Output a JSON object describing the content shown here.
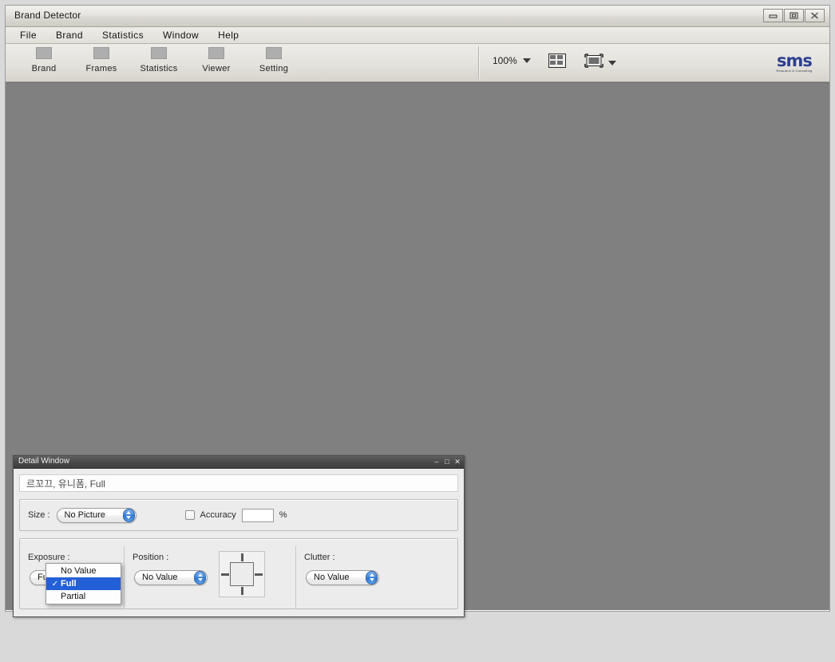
{
  "window": {
    "title": "Brand Detector",
    "controls": [
      {
        "name": "minimize",
        "glyph": "minimize-icon"
      },
      {
        "name": "maximize",
        "glyph": "maximize-icon"
      },
      {
        "name": "close",
        "glyph": "close-icon"
      }
    ]
  },
  "menu": {
    "items": [
      {
        "label": "File"
      },
      {
        "label": "Brand"
      },
      {
        "label": "Statistics"
      },
      {
        "label": "Window"
      },
      {
        "label": "Help"
      }
    ]
  },
  "toolbar": {
    "buttons": [
      {
        "label": "Brand",
        "icon": "brand-icon"
      },
      {
        "label": "Frames",
        "icon": "frames-icon"
      },
      {
        "label": "Statistics",
        "icon": "statistics-icon"
      },
      {
        "label": "Viewer",
        "icon": "viewer-icon"
      },
      {
        "label": "Setting",
        "icon": "setting-icon"
      }
    ],
    "zoom_value": "100%",
    "grid_icon": "thumbnail-grid-icon",
    "view_icon": "display-view-icon",
    "logo": {
      "word": "sms",
      "subtitle": "Research & Consulting"
    }
  },
  "detail_window": {
    "title": "Detail Window",
    "controls": [
      {
        "name": "minimize",
        "glyph": "–"
      },
      {
        "name": "maximize",
        "glyph": "□"
      },
      {
        "name": "close",
        "glyph": "✕"
      }
    ],
    "caption": "르꼬끄, 유니폼, Full",
    "size": {
      "label": "Size :",
      "value": "No Picture"
    },
    "accuracy": {
      "label": "Accuracy",
      "checked": false,
      "value": "",
      "unit": "%"
    },
    "exposure": {
      "label": "Exposure :",
      "value": "Full",
      "menu_open": true,
      "options": [
        {
          "label": "No Value",
          "checked": false
        },
        {
          "label": "Full",
          "checked": true
        },
        {
          "label": "Partial",
          "checked": false
        }
      ]
    },
    "position": {
      "label": "Position :",
      "value": "No Value",
      "widget": "position-grid-widget"
    },
    "clutter": {
      "label": "Clutter :",
      "value": "No Value"
    }
  },
  "colors": {
    "workspace": "#808080",
    "chrome": "#d4d0c8",
    "selection_blue": "#2360d8",
    "logo_blue": "#2d3f8f",
    "detail_titlebar": "#4a4a4a"
  }
}
